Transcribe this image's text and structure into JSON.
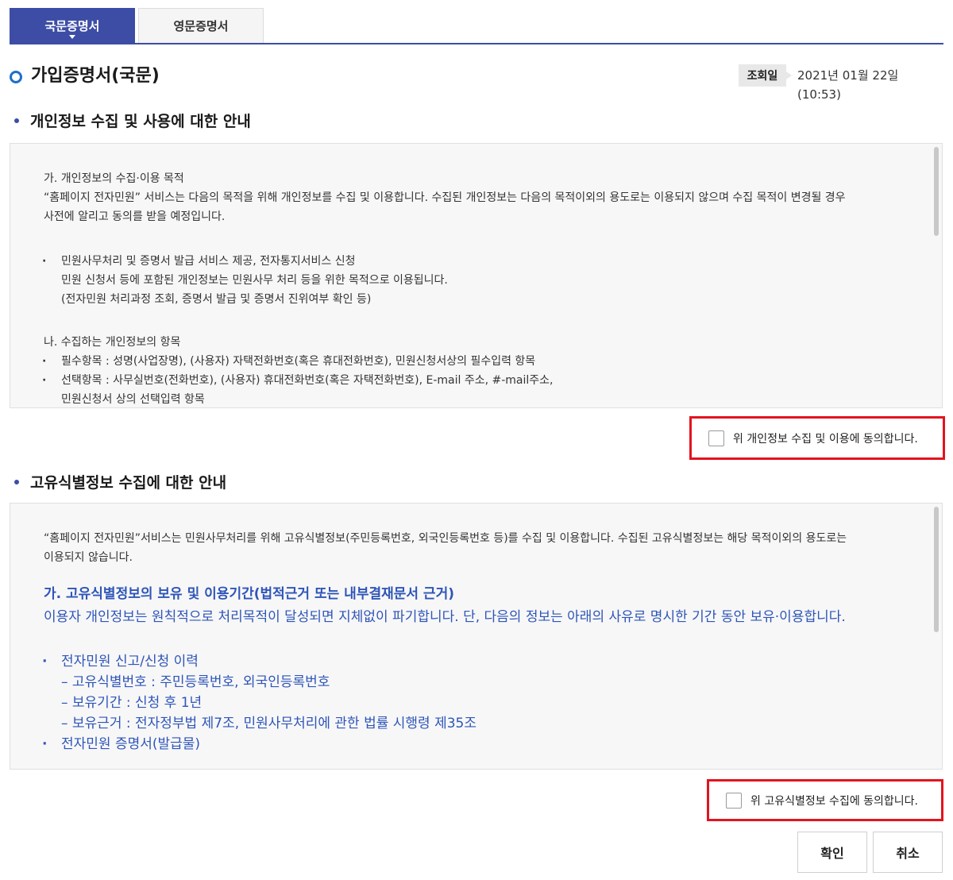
{
  "tabs": {
    "korean": "국문증명서",
    "english": "영문증명서"
  },
  "header": {
    "title": "가입증명서(국문)",
    "date_label": "조회일",
    "date_value": "2021년 01월 22일 (10:53)"
  },
  "section1": {
    "title": "개인정보 수집 및 사용에 대한 안내",
    "a_heading": "가. 개인정보의 수집·이용 목적",
    "a_text_1": "“홈페이지 전자민원” 서비스는 다음의 목적을 위해 개인정보를 수집 및 이용합니다. 수집된 개인정보는 다음의 목적이외의 용도로는 이용되지 않으며 수집 목적이 변경될 경우",
    "a_text_2": "사전에 알리고 동의를 받을 예정입니다.",
    "a_bullet_1": "민원사무처리 및 증명서 발급 서비스 제공, 전자통지서비스 신청",
    "a_bullet_1_l2": "민원 신청서 등에 포함된 개인정보는 민원사무 처리 등을 위한 목적으로 이용됩니다.",
    "a_bullet_1_l3": "(전자민원 처리과정 조회, 증명서 발급 및 증명서 진위여부 확인 등)",
    "b_heading": "나. 수집하는 개인정보의 항목",
    "b_bullet_1": "필수항목 : 성명(사업장명), (사용자) 자택전화번호(혹은 휴대전화번호), 민원신청서상의 필수입력 항목",
    "b_bullet_2": "선택항목 : 사무실번호(전화번호), (사용자) 휴대전화번호(혹은 자택전화번호), E-mail 주소, #-mail주소,",
    "b_bullet_2_l2": "민원신청서 상의 선택입력 항목",
    "agree_label": "위 개인정보 수집 및 이용에 동의합니다."
  },
  "section2": {
    "title": "고유식별정보 수집에 대한 안내",
    "intro_1": "“홈페이지 전자민원”서비스는 민원사무처리를 위해 고유식별정보(주민등록번호, 외국인등록번호 등)를 수집 및 이용합니다. 수집된 고유식별정보는 해당 목적이외의 용도로는",
    "intro_2": "이용되지 않습니다.",
    "a_heading": "가. 고유식별정보의 보유 및 이용기간(법적근거 또는 내부결재문서 근거)",
    "a_text": "이용자 개인정보는 원칙적으로 처리목적이 달성되면 지체없이 파기합니다. 단, 다음의 정보는 아래의 사유로 명시한 기간 동안 보유·이용합니다.",
    "bullet_1": "전자민원 신고/신청 이력",
    "sub_1": "– 고유식별번호 : 주민등록번호, 외국인등록번호",
    "sub_2": "– 보유기간 : 신청 후 1년",
    "sub_3": "– 보유근거 : 전자정부법 제7조, 민원사무처리에 관한 법률 시행령 제35조",
    "bullet_2": "전자민원 증명서(발급물)",
    "agree_label": "위 고유식별정보 수집에 동의합니다."
  },
  "buttons": {
    "confirm": "확인",
    "cancel": "취소"
  },
  "colors": {
    "accent": "#3d4da5",
    "highlight": "#e3141e",
    "link_blue": "#2e55b8"
  }
}
